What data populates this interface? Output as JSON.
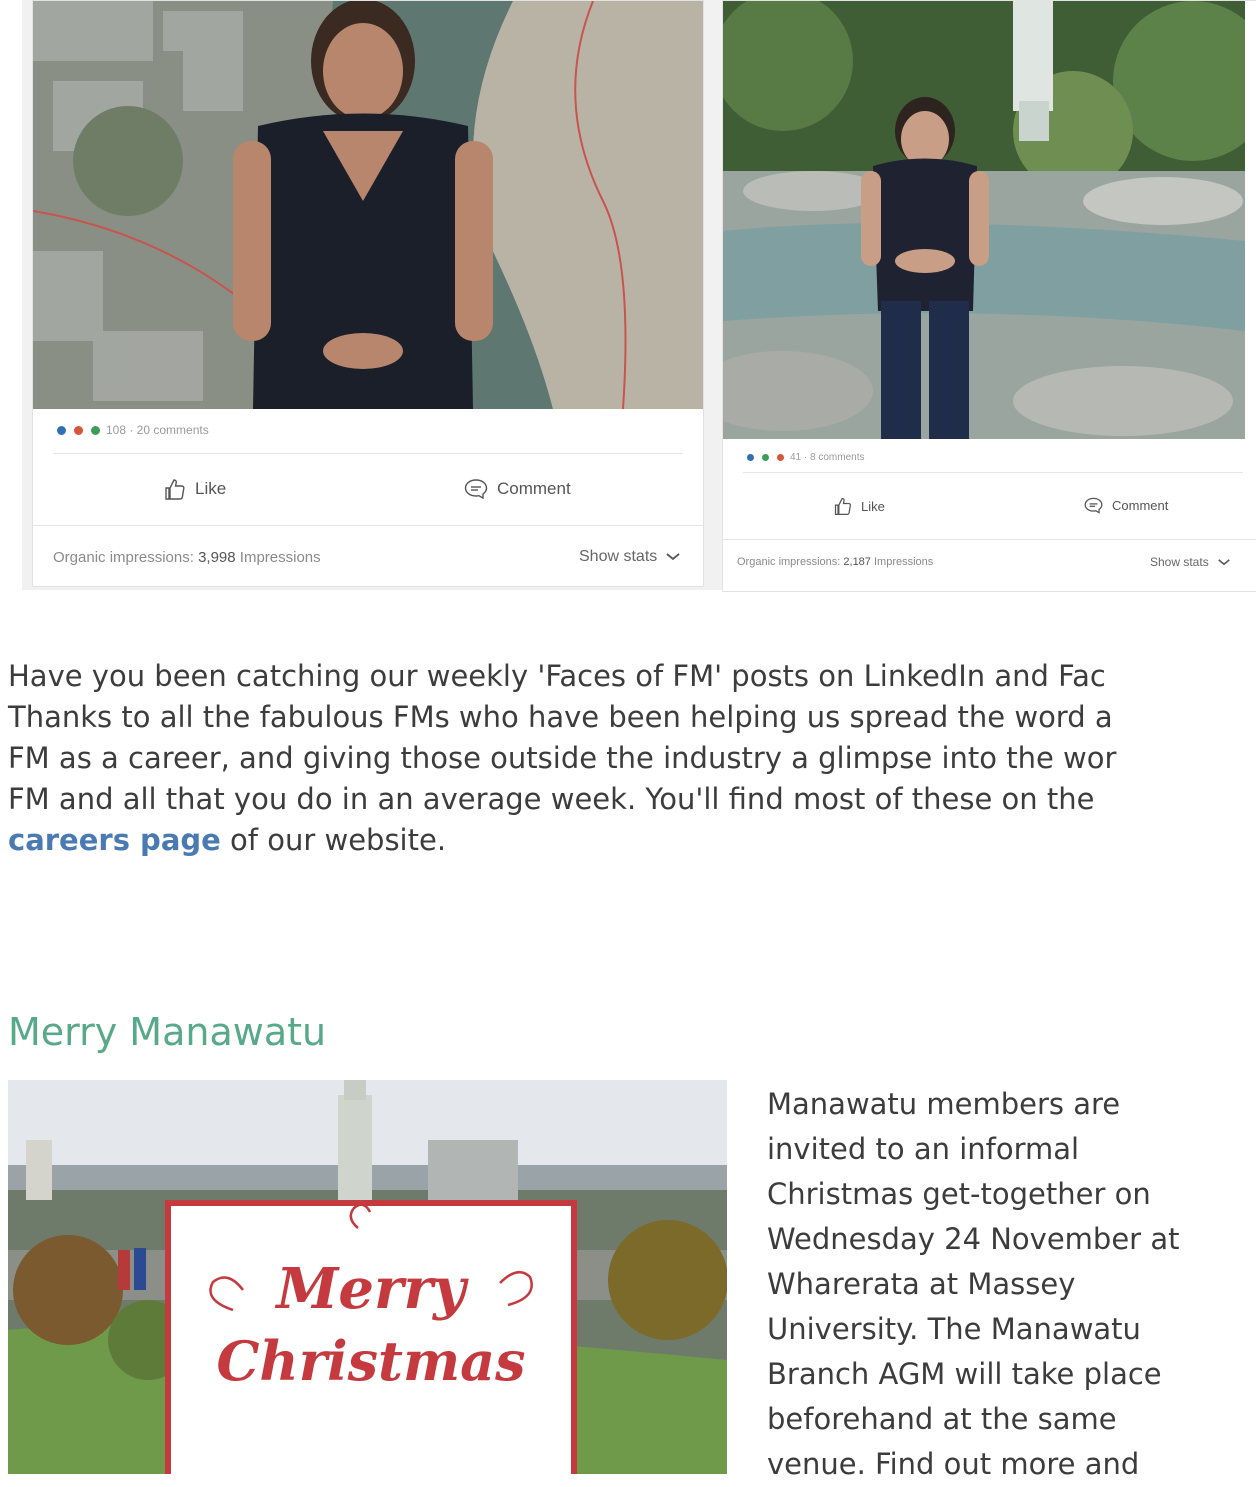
{
  "social_posts": [
    {
      "reaction_count_text": "108 · 20 comments",
      "like_label": "Like",
      "comment_label": "Comment",
      "impressions_prefix": "Organic impressions:",
      "impressions_value": "3,998",
      "impressions_suffix": "Impressions",
      "show_stats_label": "Show stats"
    },
    {
      "reaction_count_text": "41 · 8 comments",
      "like_label": "Like",
      "comment_label": "Comment",
      "impressions_prefix": "Organic impressions:",
      "impressions_value": "2,187",
      "impressions_suffix": "Impressions",
      "show_stats_label": "Show stats"
    }
  ],
  "article": {
    "lines": [
      "Have you been catching our weekly 'Faces of FM' posts on LinkedIn and Fac",
      "Thanks to all the fabulous FMs who have been helping us spread the word a",
      "FM as a career, and giving those outside the industry a glimpse into the wor",
      "FM and all that you do in an average week. You'll find most of these on the"
    ],
    "link_text": "careers page",
    "after_link": " of our website."
  },
  "section": {
    "title": "Merry Manawatu",
    "image_text_1": "Merry",
    "image_text_2": "Christmas",
    "body_lines": [
      "Manawatu members are",
      "invited to an informal",
      "Christmas get-together on",
      "Wednesday 24 November at",
      "Wharerata at Massey",
      "University. The Manawatu",
      "Branch AGM will take place",
      "beforehand at the same",
      "venue. Find out more and"
    ]
  },
  "colors": {
    "link": "#4b7ab3",
    "section_title": "#58a98a",
    "body_text": "#3c3c3c"
  }
}
